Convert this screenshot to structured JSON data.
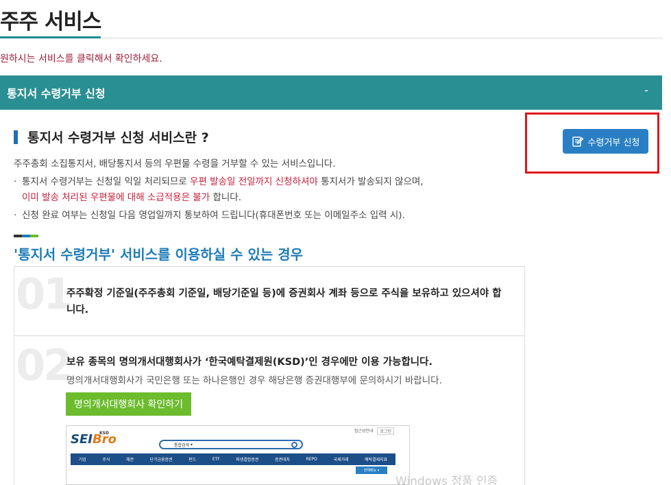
{
  "page": {
    "title": "주주 서비스",
    "intro": "원하시는 서비스를 클릭해서 확인하세요."
  },
  "accordion": {
    "label": "통지서 수령거부 신청",
    "toggle": "-"
  },
  "apply_button": {
    "label": "수령거부 신청",
    "icon": "edit-document-icon"
  },
  "section": {
    "title": "통지서 수령거부 신청 서비스란 ?",
    "description": "주주총회 소집통지서, 배당통지서 등의 우편물 수령을 거부할 수 있는 서비스입니다.",
    "bullet1": {
      "dot": "·",
      "pre": "통지서 수령거부는 신청일 익일 처리되므로 ",
      "highlight": "우편 발송일 전일까지 신청하셔야",
      "post": " 통지서가 발송되지 않으며,"
    },
    "bullet1_cont": {
      "highlight": "이미 발송 처리된 우편물에 대해 소급적용은 불가",
      "post": " 합니다."
    },
    "bullet2": {
      "dot": "·",
      "text": "신청 완료 여부는 신청일 다음 영업일까지 통보하여 드립니다(휴대폰번호 또는 이메일주소 입력 시)."
    }
  },
  "usage": {
    "title": "'통지서 수령거부' 서비스를 이용하실 수 있는 경우",
    "deco_colors": [
      "#333333",
      "#1d7bb8",
      "#6cbc2e"
    ],
    "cases": [
      {
        "number": "01",
        "text": "주주확정 기준일(주주총회 기준일, 배당기준일 등)에 증권회사 계좌 등으로 주식을 보유하고 있으셔야 합니다."
      },
      {
        "number": "02",
        "text": "보유 종목의 명의개서대행회사가 ‘한국예탁결제원(KSD)’인 경우에만 이용 가능합니다.",
        "sub": "명의개서대행회사가 국민은행 또는 하나은행인 경우 해당은행 증권대행부에 문의하시기 바랍니다.",
        "button": "명의개서대행회사 확인하기"
      }
    ]
  },
  "embed": {
    "topbar_link": "접근성안내",
    "topbar_login": "로그인",
    "logo_main": "SEIBro",
    "logo_ksd": "KSD",
    "search_select": "통합검색",
    "nav": [
      "기업",
      "주식",
      "채권",
      "단기금융증권",
      "펀드",
      "ETF",
      "파생결합증권",
      "증권대차",
      "REPO",
      "국제거래",
      "예탁결제지표"
    ],
    "all_menu": "전체메뉴"
  },
  "watermark": "Windows 정품 인증",
  "colors": {
    "teal": "#2a8f93",
    "blue": "#2a7fc4",
    "accent_red": "#c8203a",
    "green": "#6cbc2e",
    "highlight_border": "#e0141b"
  }
}
